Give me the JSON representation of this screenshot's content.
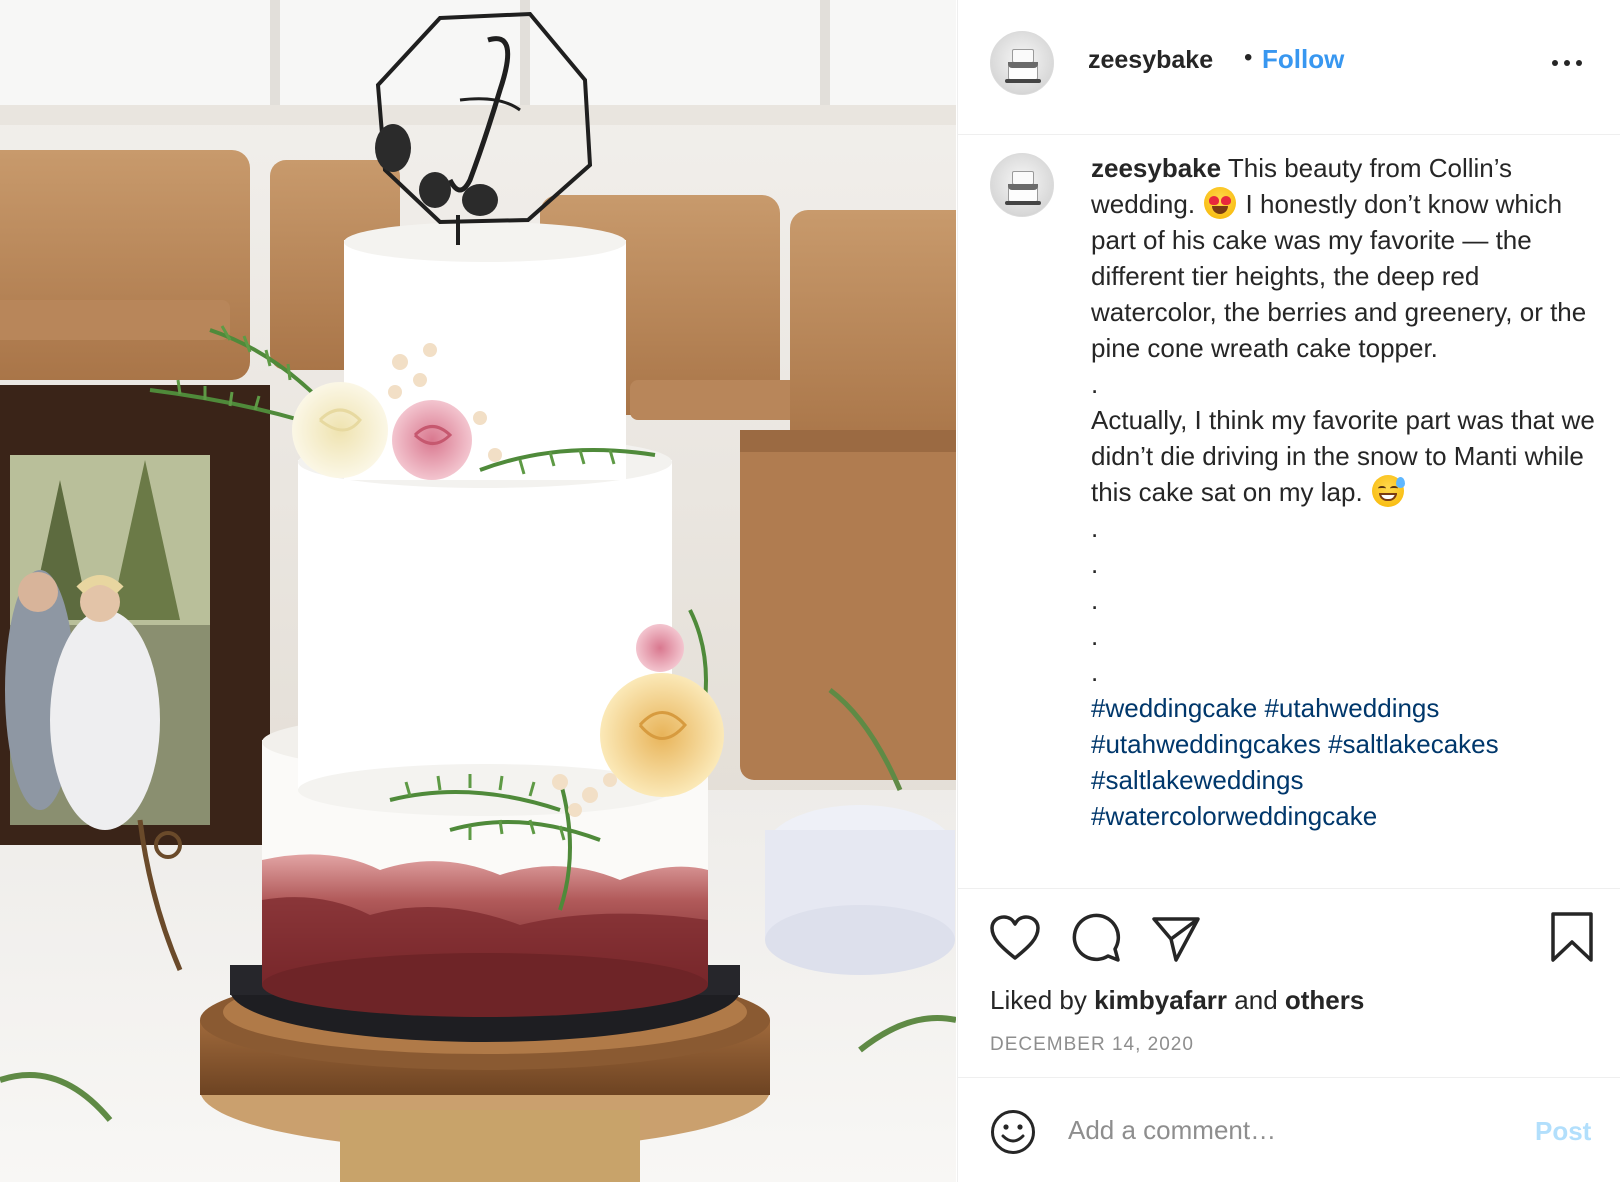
{
  "post": {
    "username": "zeesybake",
    "follow_separator": "•",
    "follow_label": "Follow",
    "more_icon": "more-options-icon"
  },
  "caption": {
    "username": "zeesybake",
    "part1": " This beauty from Collin’s wedding. ",
    "part2": " I honestly don’t know which part of his cake was my favorite — the different tier heights, the deep red watercolor, the berries and greenery, or the pine cone wreath cake topper.",
    "sep1": ".",
    "part3": "Actually, I think my favorite part was that we didn’t die driving in the snow to Manti while this cake sat on my lap. ",
    "sep2": ".",
    "sep3": ".",
    "sep4": ".",
    "sep5": ".",
    "sep6": ".",
    "emoji1": "heart-eyes-emoji",
    "emoji2": "grinning-sweat-emoji",
    "hashtags": [
      "#weddingcake",
      "#utahweddings",
      "#utahweddingcakes",
      "#saltlakecakes",
      "#saltlakeweddings",
      "#watercolorweddingcake"
    ]
  },
  "engagement": {
    "liked_by_prefix": "Liked by ",
    "liked_by_user": "kimbyafarr",
    "liked_by_and": " and ",
    "liked_by_others": "others",
    "date": "DECEMBER 14, 2020"
  },
  "comment": {
    "placeholder": "Add a comment…",
    "post_label": "Post"
  },
  "colors": {
    "link_blue": "#3897f0",
    "hashtag_blue": "#00376b",
    "post_disabled": "#b2dffc",
    "muted": "#8e8e8e"
  }
}
